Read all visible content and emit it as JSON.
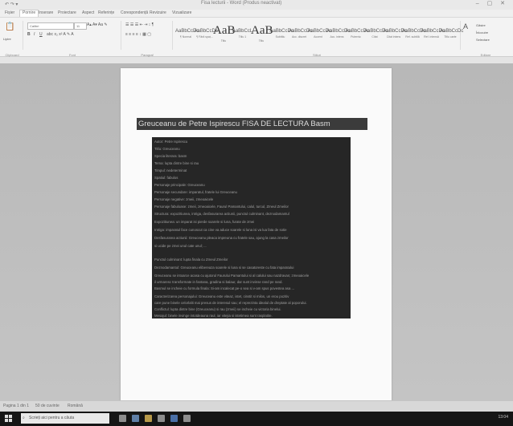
{
  "window": {
    "title": "Fisa lecturii - Word (Produs neactivat)",
    "quick_access": "↶ ↷ ▾",
    "controls": "– ▢ ✕"
  },
  "tabs": [
    {
      "label": "Fișier"
    },
    {
      "label": "Pornire"
    },
    {
      "label": "Inserare"
    },
    {
      "label": "Proiectare"
    },
    {
      "label": "Aspect"
    },
    {
      "label": "Referințe"
    },
    {
      "label": "Corespondență"
    },
    {
      "label": "Revizuire"
    },
    {
      "label": "Vizualizare"
    }
  ],
  "ribbon": {
    "font_name": "Calibri",
    "font_size": "11",
    "paste_label": "Lipire",
    "groups": {
      "clipboard": "Clipboard",
      "font": "Font",
      "paragraph": "Paragraf",
      "styles": "Stiluri",
      "editing": "Editare"
    },
    "styles": [
      {
        "sample": "AaBbCcDc",
        "name": "¶ Normal"
      },
      {
        "sample": "AaBbCcDc",
        "name": "¶ Fără spaț..."
      },
      {
        "sample": "AaB",
        "name": "Titlu",
        "big": true
      },
      {
        "sample": "AaBbCcL",
        "name": "Titlu 1"
      },
      {
        "sample": "AaB",
        "name": "Titlu",
        "big": true
      },
      {
        "sample": "AaBbCcDc",
        "name": "Subtitlu"
      },
      {
        "sample": "AaBbCcDc",
        "name": "Acc. discret"
      },
      {
        "sample": "AaBbCcDc",
        "name": "Accent"
      },
      {
        "sample": "AaBbCcDc",
        "name": "Acc. intens"
      },
      {
        "sample": "AaBbCcDc",
        "name": "Puternic"
      },
      {
        "sample": "AaBbCcDc",
        "name": "Citat"
      },
      {
        "sample": "AaBbCcDc",
        "name": "Citat intens"
      },
      {
        "sample": "AaBbCcDc",
        "name": "Ref. subtilă"
      },
      {
        "sample": "AaBbCcDc",
        "name": "Ref. intensă"
      },
      {
        "sample": "AaBbCcDc",
        "name": "Titlu carte"
      }
    ],
    "editing": [
      "Găsire",
      "Înlocuire",
      "Selectare"
    ]
  },
  "document": {
    "heading": "Greuceanu de Petre Ispirescu FISA DE LECTURA Basm",
    "lines": [
      "Autor: Petre Ispirescu",
      "Titlu: Greuceanu",
      "Specia literara: basm",
      "Tema: lupta dintre bine si rau",
      "Timpul: nedeterminat",
      "Spatiul: fabulos",
      "Personaje principale: Greuceanu",
      "Personaje secundare: imparatul, fratele lui Greuceanu",
      "Personaje negative: zmeii, zmeoaicele",
      "Personaje fabuloase: zmeii, zmeoaicele, Faurul Pamantului, calul, turcul, Zmeul Zmeilor",
      "Structura: expozitiunea, intriga, desfasurarea actiunii, punctul culminant, deznodamantul",
      "Expozitiunea: un imparat isi pierde soarele si luna, furate de zmei",
      "Intriga: imparatul face cunoscut ca cine va aduce soarele si luna isi va lua fata de sotie",
      "Desfasurarea actiunii: Greuceanu pleaca impreuna cu fratele sau, ajung la casa zmeilor",
      "si ucide pe zmei unul cate unul; ...",
      "",
      "Punctul culminant: lupta finala cu Zmeul Zmeilor",
      "Deznodamantul: Greuceanu elibereaza soarele si luna si se casatoreste cu fata imparatului",
      "Greuceanu se intoarce acasa cu ajutorul Faurului Pamantului si al calului sau nazdravan; zmeoaicele",
      "il urmaresc transformate in fantana, gradina si balaur, dar sunt invinse rand pe rand.",
      "Basmul se incheie cu formula finala: Si-am incalecat pe-o sea si v-am spus povestea asa ...",
      "Caracterizarea personajului: Greuceanu este viteaz, istet, cinstit si milos, un erou pozitiv",
      "care pune binele celorlalti mai presus de interesul sau; el reprezinta idealul de dreptate al poporului.",
      "Conflictul: lupta dintre bine (Greuceanu) si rau (zmeii) se incheie cu victoria binelui.",
      "Mesajul: binele invinge intotdeauna raul, iar vitejia si istetimea sunt rasplatite."
    ]
  },
  "status": {
    "page": "Pagina 1 din 1",
    "words": "50 de cuvinte",
    "language": "Română"
  },
  "taskbar": {
    "search_placeholder": "Scrieți aici pentru a căuta",
    "clock": "13:04"
  }
}
